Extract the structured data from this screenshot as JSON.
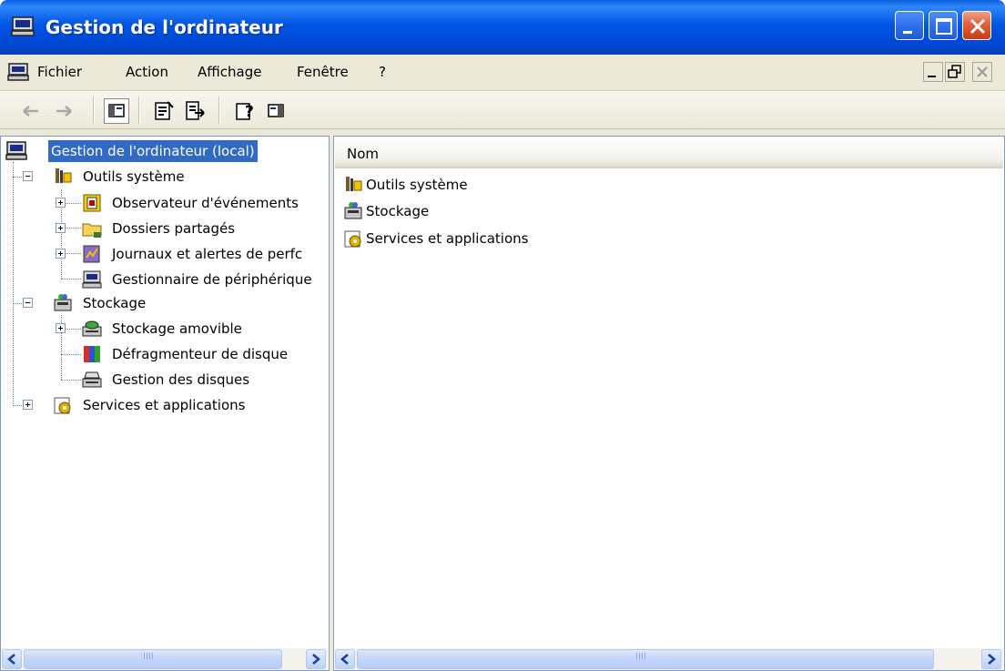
{
  "window": {
    "title": "Gestion de l'ordinateur",
    "controls": [
      "minimize",
      "maximize",
      "close"
    ]
  },
  "menubar": {
    "items": [
      "Fichier",
      "Action",
      "Affichage",
      "Fenêtre",
      "?"
    ]
  },
  "toolbar": {
    "buttons": [
      "back-arrow-icon",
      "forward-arrow-icon",
      "show-hide-tree-icon",
      "properties-icon",
      "export-list-icon",
      "help-icon",
      "show-hide-action-pane-icon"
    ]
  },
  "tree": {
    "root": "Gestion de l'ordinateur (local)",
    "system_tools": "Outils système",
    "event_viewer": "Observateur d'événements",
    "shared_folders": "Dossiers partagés",
    "perf_logs": "Journaux et alertes de perfc",
    "device_manager": "Gestionnaire de périphérique",
    "storage": "Stockage",
    "removable_storage": "Stockage amovible",
    "defragmenter": "Défragmenteur de disque",
    "disk_management": "Gestion des disques",
    "services_apps": "Services et applications"
  },
  "list": {
    "column_header": "Nom",
    "items": [
      "Outils système",
      "Stockage",
      "Services et applications"
    ]
  },
  "scrollbar": {
    "grip": "IIII"
  },
  "colors": {
    "titlebar": "#0055e5",
    "selection": "#316ac5",
    "chrome": "#ece9d8"
  }
}
